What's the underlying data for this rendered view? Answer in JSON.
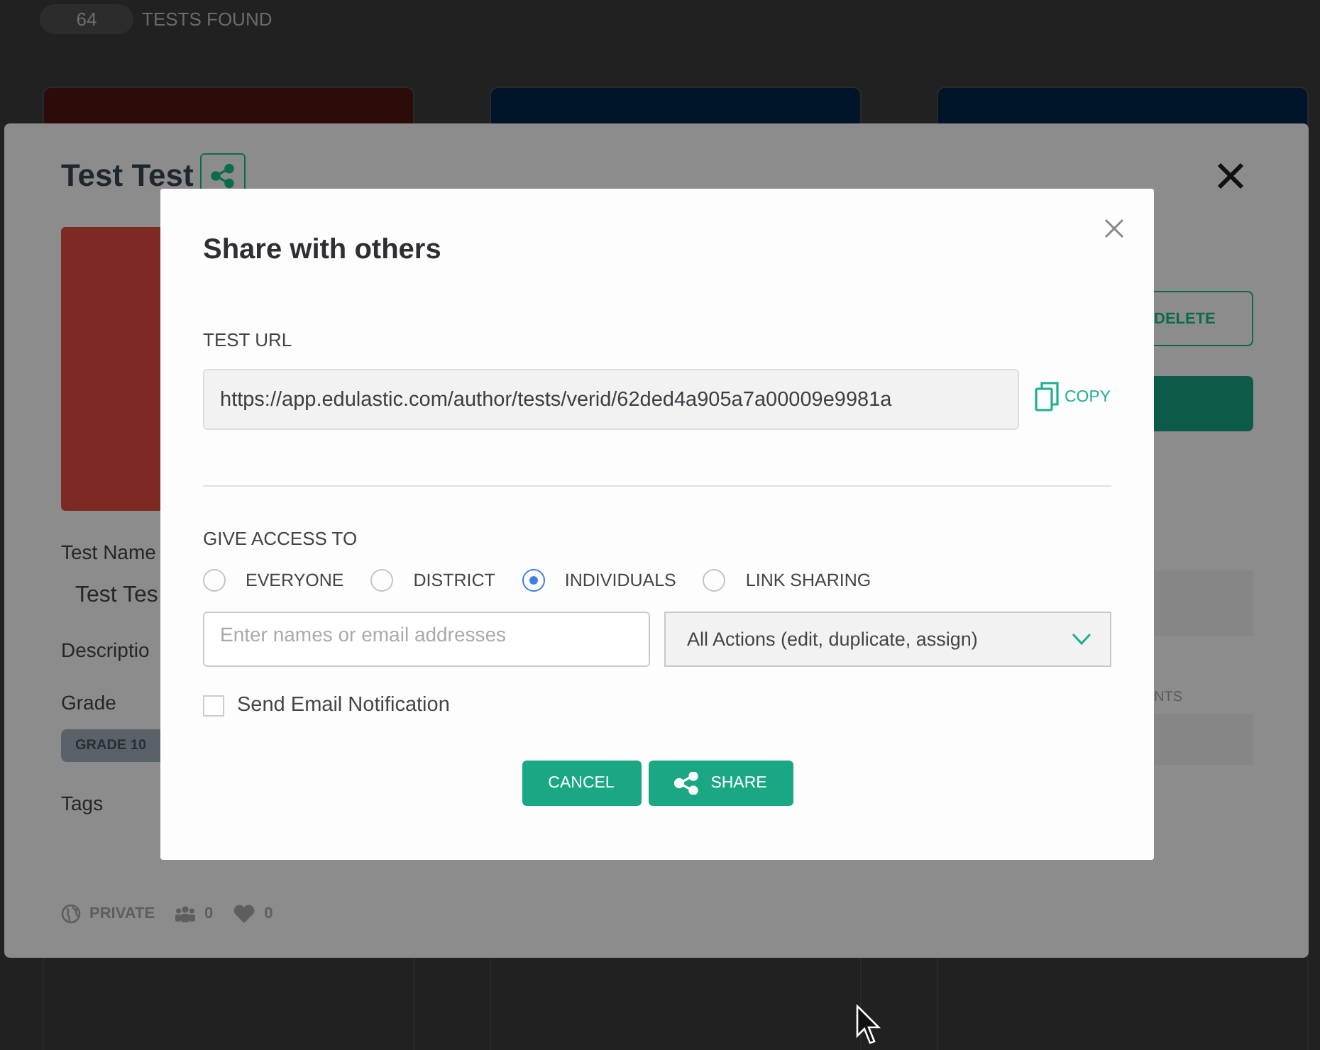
{
  "header": {
    "count": "64",
    "label": "TESTS FOUND"
  },
  "cards": [
    {
      "color": "#2b0c09"
    },
    {
      "color": "#001529"
    },
    {
      "color": "#001529"
    }
  ],
  "test_panel": {
    "title": "Test Test",
    "fields": [
      {
        "label": "Test Name",
        "value": "Test Tes"
      },
      {
        "label": "Descriptio"
      },
      {
        "label": "Grade",
        "tags": [
          "GRADE 10"
        ]
      },
      {
        "label": "Tags"
      }
    ],
    "actions": [
      {
        "kind": "outline",
        "label": "DELETE"
      },
      {
        "kind": "filled"
      }
    ],
    "side_label": "NTS",
    "visibility": "PRIVATE",
    "followers": "0",
    "likes": "0"
  },
  "share_dialog": {
    "title": "Share with others",
    "url_label": "TEST URL",
    "url": "https://app.edulastic.com/author/tests/verid/62ded4a905a7a00009e9981a",
    "copy": "COPY",
    "access_label": "GIVE ACCESS TO",
    "options": [
      {
        "label": "EVERYONE",
        "selected": false
      },
      {
        "label": "DISTRICT",
        "selected": false
      },
      {
        "label": "INDIVIDUALS",
        "selected": true
      },
      {
        "label": "LINK SHARING",
        "selected": false
      }
    ],
    "people_placeholder": "Enter names or email addresses",
    "permission": "All Actions (edit, duplicate, assign)",
    "notify": {
      "label": "Send Email Notification",
      "checked": false
    },
    "buttons": [
      {
        "kind": "cancel",
        "label": "CANCEL"
      },
      {
        "kind": "share",
        "label": "SHARE"
      }
    ]
  }
}
